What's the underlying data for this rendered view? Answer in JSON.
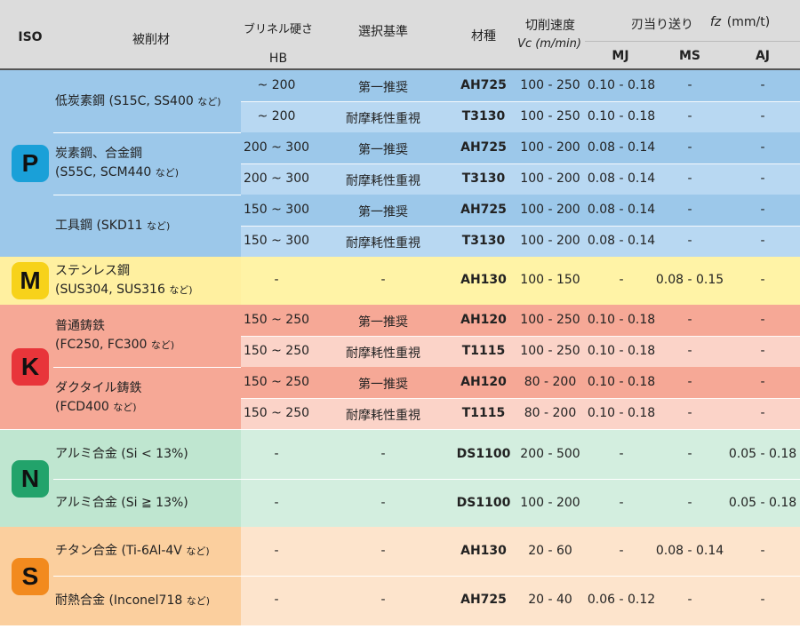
{
  "header": {
    "iso": "ISO",
    "material": "被削材",
    "hardness_1": "ブリネル硬さ",
    "hardness_2": "HB",
    "selection": "選択基準",
    "grade": "材種",
    "speed_1": "切削速度",
    "speed_2": "Vc (m/min)",
    "feed": "刃当り送り",
    "feed_symbol": "fz",
    "feed_unit": "(mm/t)",
    "mj": "MJ",
    "ms": "MS",
    "aj": "AJ"
  },
  "groups": [
    {
      "iso": "P",
      "badge_color": "#1aa0d8",
      "band_light": "#b8d8f2",
      "band_dark": "#9cc8ea",
      "materials": [
        {
          "name": "低炭素鋼 (S15C, SS400",
          "note": "など)",
          "rows": [
            {
              "hb": "~ 200",
              "sel": "第一推奨",
              "grade": "AH725",
              "vc": "100 - 250",
              "mj": "0.10 - 0.18",
              "ms": "-",
              "aj": "-"
            },
            {
              "hb": "~ 200",
              "sel": "耐摩耗性重視",
              "grade": "T3130",
              "vc": "100 - 250",
              "mj": "0.10 - 0.18",
              "ms": "-",
              "aj": "-"
            }
          ]
        },
        {
          "name": "炭素鋼、合金鋼",
          "name2": "(S55C, SCM440",
          "note": "など)",
          "rows": [
            {
              "hb": "200 ~ 300",
              "sel": "第一推奨",
              "grade": "AH725",
              "vc": "100 - 200",
              "mj": "0.08 - 0.14",
              "ms": "-",
              "aj": "-"
            },
            {
              "hb": "200 ~ 300",
              "sel": "耐摩耗性重視",
              "grade": "T3130",
              "vc": "100 - 200",
              "mj": "0.08 - 0.14",
              "ms": "-",
              "aj": "-"
            }
          ]
        },
        {
          "name": "工具鋼 (SKD11",
          "note": "など)",
          "rows": [
            {
              "hb": "150 ~ 300",
              "sel": "第一推奨",
              "grade": "AH725",
              "vc": "100 - 200",
              "mj": "0.08 - 0.14",
              "ms": "-",
              "aj": "-"
            },
            {
              "hb": "150 ~ 300",
              "sel": "耐摩耗性重視",
              "grade": "T3130",
              "vc": "100 - 200",
              "mj": "0.08 - 0.14",
              "ms": "-",
              "aj": "-"
            }
          ]
        }
      ]
    },
    {
      "iso": "M",
      "badge_color": "#f7d21a",
      "band_light": "#fff3a6",
      "band_dark": "#fff0a0",
      "materials": [
        {
          "name": "ステンレス鋼",
          "name2": "(SUS304, SUS316",
          "note": "など)",
          "rows": [
            {
              "hb": "-",
              "sel": "-",
              "grade": "AH130",
              "vc": "100 - 150",
              "mj": "-",
              "ms": "0.08 - 0.15",
              "aj": "-"
            }
          ]
        }
      ]
    },
    {
      "iso": "K",
      "badge_color": "#e8353a",
      "band_light": "#fbd3c8",
      "band_dark": "#f6a896",
      "materials": [
        {
          "name": "普通鋳鉄",
          "name2": "(FC250, FC300",
          "note": "など)",
          "rows": [
            {
              "hb": "150 ~ 250",
              "sel": "第一推奨",
              "grade": "AH120",
              "vc": "100 - 250",
              "mj": "0.10 - 0.18",
              "ms": "-",
              "aj": "-"
            },
            {
              "hb": "150 ~ 250",
              "sel": "耐摩耗性重視",
              "grade": "T1115",
              "vc": "100 - 250",
              "mj": "0.10 - 0.18",
              "ms": "-",
              "aj": "-"
            }
          ]
        },
        {
          "name": "ダクタイル鋳鉄",
          "name2": "(FCD400",
          "note": "など)",
          "rows": [
            {
              "hb": "150 ~ 250",
              "sel": "第一推奨",
              "grade": "AH120",
              "vc": "80 - 200",
              "mj": "0.10 - 0.18",
              "ms": "-",
              "aj": "-"
            },
            {
              "hb": "150 ~ 250",
              "sel": "耐摩耗性重視",
              "grade": "T1115",
              "vc": "80 - 200",
              "mj": "0.10 - 0.18",
              "ms": "-",
              "aj": "-"
            }
          ]
        }
      ]
    },
    {
      "iso": "N",
      "badge_color": "#22a36b",
      "band_light": "#d3eedf",
      "band_dark": "#bfe6d0",
      "materials": [
        {
          "name": "アルミ合金 (Si < 13%)",
          "rows": [
            {
              "hb": "-",
              "sel": "-",
              "grade": "DS1100",
              "vc": "200 - 500",
              "mj": "-",
              "ms": "-",
              "aj": "0.05 - 0.18"
            }
          ]
        },
        {
          "name": "アルミ合金 (Si ≧ 13%)",
          "rows": [
            {
              "hb": "-",
              "sel": "-",
              "grade": "DS1100",
              "vc": "100 - 200",
              "mj": "-",
              "ms": "-",
              "aj": "0.05 - 0.18"
            }
          ]
        }
      ]
    },
    {
      "iso": "S",
      "badge_color": "#f28a1e",
      "band_light": "#fde4cc",
      "band_dark": "#fbcf9e",
      "materials": [
        {
          "name": "チタン合金 (Ti-6Al-4V",
          "note": "など)",
          "rows": [
            {
              "hb": "-",
              "sel": "-",
              "grade": "AH130",
              "vc": "20 - 60",
              "mj": "-",
              "ms": "0.08 - 0.14",
              "aj": "-"
            }
          ]
        },
        {
          "name": "耐熱合金 (Inconel718",
          "note": "など)",
          "rows": [
            {
              "hb": "-",
              "sel": "-",
              "grade": "AH725",
              "vc": "20 - 40",
              "mj": "0.06 - 0.12",
              "ms": "-",
              "aj": "-"
            }
          ]
        }
      ]
    }
  ]
}
